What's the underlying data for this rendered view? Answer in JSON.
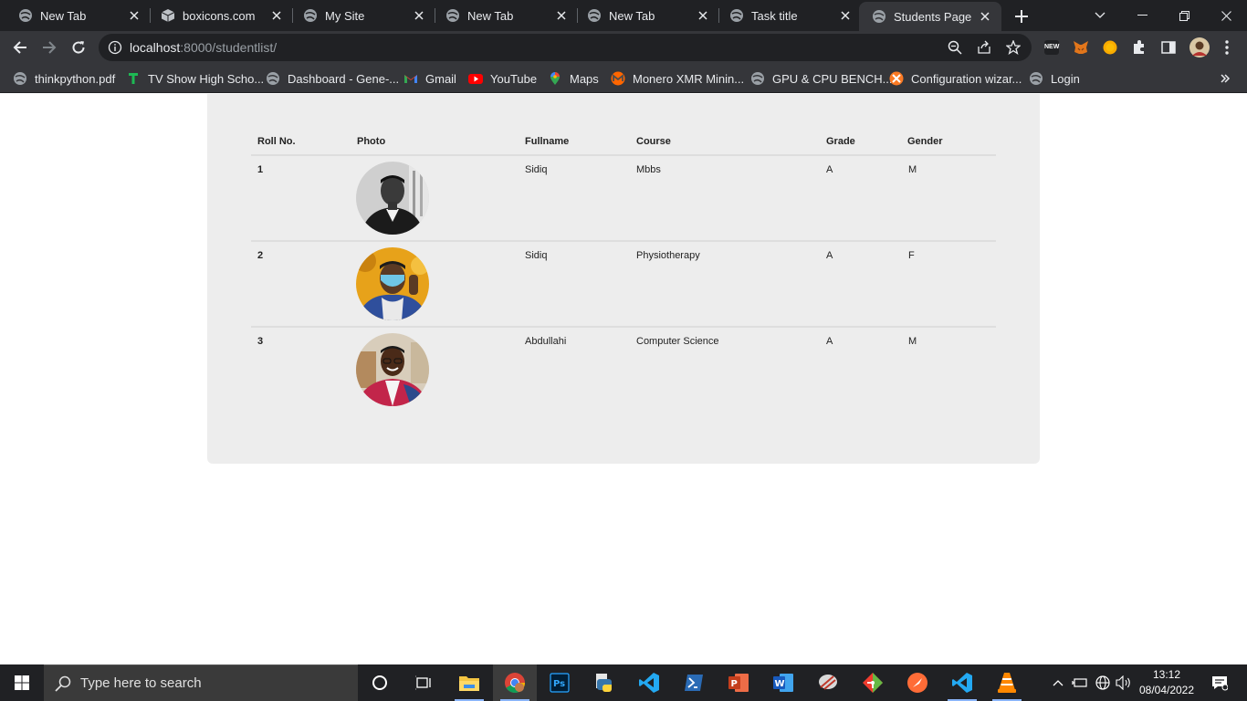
{
  "browser": {
    "tabs": [
      {
        "title": "New Tab"
      },
      {
        "title": "boxicons.com"
      },
      {
        "title": "My Site"
      },
      {
        "title": "New Tab"
      },
      {
        "title": "New Tab"
      },
      {
        "title": "Task title"
      },
      {
        "title": "Students Page",
        "active": true
      }
    ],
    "url_host": "localhost",
    "url_rest": ":8000/studentlist/",
    "bookmarks": [
      {
        "label": "thinkpython.pdf",
        "icon": "globe-icon"
      },
      {
        "label": "TV Show High Scho...",
        "icon": "t-icon"
      },
      {
        "label": "Dashboard - Gene-...",
        "icon": "globe-icon"
      },
      {
        "label": "Gmail",
        "icon": "gmail-icon"
      },
      {
        "label": "YouTube",
        "icon": "youtube-icon"
      },
      {
        "label": "Maps",
        "icon": "maps-icon"
      },
      {
        "label": "Monero XMR Minin...",
        "icon": "monero-icon"
      },
      {
        "label": "GPU & CPU BENCH...",
        "icon": "globe-icon"
      },
      {
        "label": "Configuration wizar...",
        "icon": "xampp-icon"
      },
      {
        "label": "Login",
        "icon": "globe-icon"
      }
    ],
    "ext_new_badge": "NEW"
  },
  "student_table": {
    "headers": {
      "roll": "Roll No.",
      "photo": "Photo",
      "fullname": "Fullname",
      "course": "Course",
      "grade": "Grade",
      "gender": "Gender"
    },
    "rows": [
      {
        "roll": "1",
        "fullname": "Sidiq",
        "course": "Mbbs",
        "grade": "A",
        "gender": "M"
      },
      {
        "roll": "2",
        "fullname": "Sidiq",
        "course": "Physiotherapy",
        "grade": "A",
        "gender": "F"
      },
      {
        "roll": "3",
        "fullname": "Abdullahi",
        "course": "Computer Science",
        "grade": "A",
        "gender": "M"
      }
    ]
  },
  "taskbar": {
    "search_placeholder": "Type here to search",
    "time": "13:12",
    "date": "08/04/2022"
  },
  "colors": {
    "chrome_dark": "#202124",
    "chrome_toolbar": "#35363a",
    "card_bg": "#ededed",
    "taskbar_bg": "#202124"
  }
}
